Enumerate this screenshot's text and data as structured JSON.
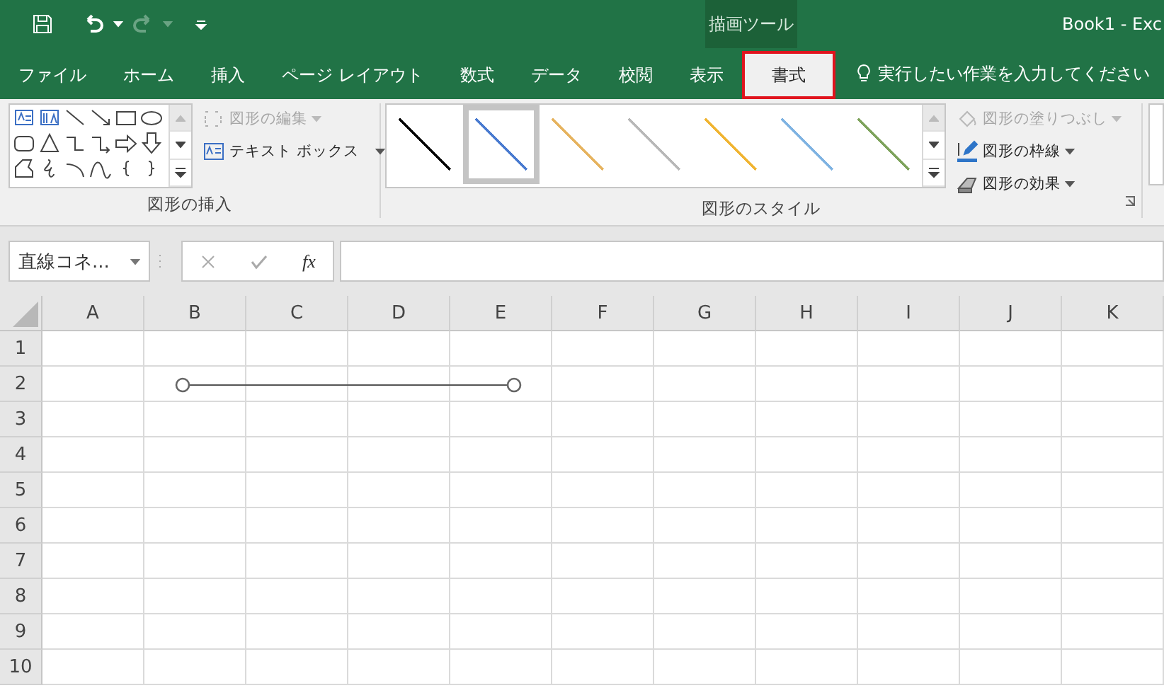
{
  "window_title": "Book1 - Exc",
  "contextual_group": "描画ツール",
  "tabs": [
    {
      "label": "ファイル",
      "selected": false,
      "highlighted": false
    },
    {
      "label": "ホーム",
      "selected": false,
      "highlighted": false
    },
    {
      "label": "挿入",
      "selected": false,
      "highlighted": false
    },
    {
      "label": "ページ レイアウト",
      "selected": false,
      "highlighted": false
    },
    {
      "label": "数式",
      "selected": false,
      "highlighted": false
    },
    {
      "label": "データ",
      "selected": false,
      "highlighted": false
    },
    {
      "label": "校閲",
      "selected": false,
      "highlighted": false
    },
    {
      "label": "表示",
      "selected": false,
      "highlighted": false
    },
    {
      "label": "書式",
      "selected": true,
      "highlighted": true
    }
  ],
  "tell_me": {
    "placeholder": "実行したい作業を入力してください"
  },
  "ribbon": {
    "insert_shapes": {
      "label": "図形の挿入",
      "edit_shape": {
        "label": "図形の編集",
        "disabled": true
      },
      "text_box": {
        "label": "テキスト ボックス",
        "disabled": false
      }
    },
    "shape_styles": {
      "label": "図形のスタイル",
      "styles": [
        {
          "color": "#000000",
          "selected": false
        },
        {
          "color": "#4a7bd0",
          "selected": true
        },
        {
          "color": "#e6b35e",
          "selected": false
        },
        {
          "color": "#b8b8b8",
          "selected": false
        },
        {
          "color": "#f0b431",
          "selected": false
        },
        {
          "color": "#7fb3e2",
          "selected": false
        },
        {
          "color": "#7ea35c",
          "selected": false
        }
      ],
      "fill": {
        "label": "図形の塗りつぶし",
        "disabled": true
      },
      "outline": {
        "label": "図形の枠線",
        "disabled": false
      },
      "effects": {
        "label": "図形の効果",
        "disabled": false
      }
    }
  },
  "name_box": {
    "value": "直線コネ..."
  },
  "formula_bar": {
    "function_label": "fx"
  },
  "grid": {
    "columns": [
      "A",
      "B",
      "C",
      "D",
      "E",
      "F",
      "G",
      "H",
      "I",
      "J",
      "K"
    ],
    "rows": [
      "1",
      "2",
      "3",
      "4",
      "5",
      "6",
      "7",
      "8",
      "9",
      "10"
    ]
  },
  "shapes": [
    {
      "kind": "connector",
      "selected": true
    }
  ]
}
